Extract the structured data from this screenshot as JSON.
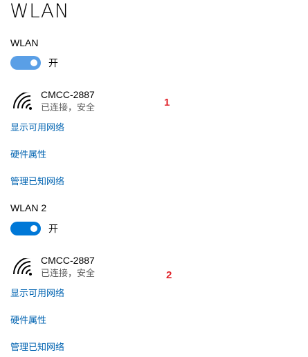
{
  "page": {
    "title": "WLAN"
  },
  "adapters": [
    {
      "label": "WLAN",
      "toggle_state": "开",
      "toggle_color": "#5a9fe6",
      "network": {
        "name": "CMCC-2887",
        "status": "已连接，安全",
        "icon": "wifi-signal-icon"
      },
      "marker": "1",
      "links": {
        "show_networks": "显示可用网络",
        "hardware_properties": "硬件属性",
        "manage_known": "管理已知网络"
      }
    },
    {
      "label": "WLAN 2",
      "toggle_state": "开",
      "toggle_color": "#0078d7",
      "network": {
        "name": "CMCC-2887",
        "status": "已连接，安全",
        "icon": "wifi-signal-icon"
      },
      "marker": "2",
      "links": {
        "show_networks": "显示可用网络",
        "hardware_properties": "硬件属性",
        "manage_known": "管理已知网络"
      }
    }
  ],
  "colors": {
    "link": "#0063b1",
    "marker": "#e0232a",
    "status_text": "#5c5c5c"
  }
}
